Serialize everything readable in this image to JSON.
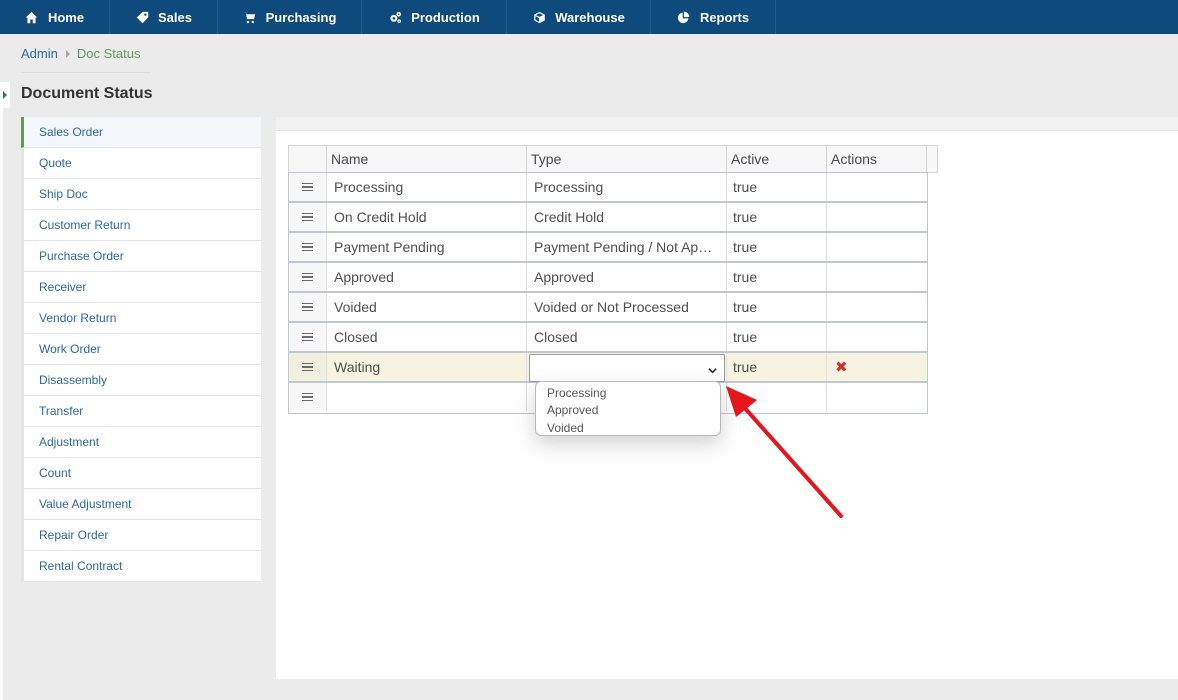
{
  "nav": {
    "items": [
      {
        "label": "Home",
        "icon": "home-icon"
      },
      {
        "label": "Sales",
        "icon": "tag-icon"
      },
      {
        "label": "Purchasing",
        "icon": "cart-icon"
      },
      {
        "label": "Production",
        "icon": "gears-icon"
      },
      {
        "label": "Warehouse",
        "icon": "cube-icon"
      },
      {
        "label": "Reports",
        "icon": "pie-chart-icon"
      }
    ]
  },
  "breadcrumb": {
    "root": "Admin",
    "current": "Doc Status"
  },
  "page": {
    "title": "Document Status"
  },
  "sidebar": {
    "items": [
      {
        "label": "Sales Order"
      },
      {
        "label": "Quote"
      },
      {
        "label": "Ship Doc"
      },
      {
        "label": "Customer Return"
      },
      {
        "label": "Purchase Order"
      },
      {
        "label": "Receiver"
      },
      {
        "label": "Vendor Return"
      },
      {
        "label": "Work Order"
      },
      {
        "label": "Disassembly"
      },
      {
        "label": "Transfer"
      },
      {
        "label": "Adjustment"
      },
      {
        "label": "Count"
      },
      {
        "label": "Value Adjustment"
      },
      {
        "label": "Repair Order"
      },
      {
        "label": "Rental Contract"
      }
    ],
    "active_index": 0
  },
  "grid": {
    "columns": {
      "name": "Name",
      "type": "Type",
      "active": "Active",
      "actions": "Actions"
    },
    "rows": [
      {
        "name": "Processing",
        "type": "Processing",
        "active": "true"
      },
      {
        "name": "On Credit Hold",
        "type": "Credit Hold",
        "active": "true"
      },
      {
        "name": "Payment Pending",
        "type": "Payment Pending / Not Ap…",
        "active": "true"
      },
      {
        "name": "Approved",
        "type": "Approved",
        "active": "true"
      },
      {
        "name": "Voided",
        "type": "Voided or Not Processed",
        "active": "true"
      },
      {
        "name": "Closed",
        "type": "Closed",
        "active": "true"
      },
      {
        "name": "Waiting",
        "type": "",
        "active": "true"
      }
    ],
    "type_options": [
      "Processing",
      "Approved",
      "Voided"
    ]
  },
  "colors": {
    "navbar": "#0e4a7c",
    "link": "#2c6aa0",
    "active_green": "#629b58",
    "arrow": "#e8141b",
    "delete": "#d03131"
  }
}
